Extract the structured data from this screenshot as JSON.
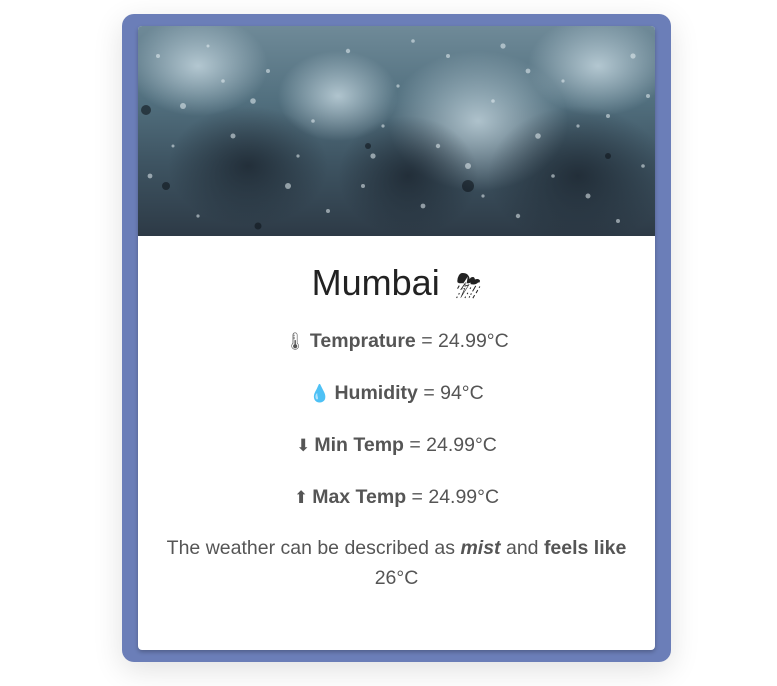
{
  "city": "Mumbai",
  "weather_icon": "storm-cloud-icon",
  "weather_glyph": "⛈",
  "stats": [
    {
      "icon": "thermometer-icon",
      "glyph": "🌡",
      "label": "Temprature",
      "value": "= 24.99°C"
    },
    {
      "icon": "droplet-icon",
      "glyph": "💧",
      "label": "Humidity",
      "value": "= 94°C"
    },
    {
      "icon": "arrow-down-icon",
      "glyph": "⬇",
      "label": "Min Temp",
      "value": "= 24.99°C"
    },
    {
      "icon": "arrow-up-icon",
      "glyph": "⬆",
      "label": "Max Temp",
      "value": "= 24.99°C"
    }
  ],
  "description": {
    "prefix": "The weather can be described as",
    "condition": "mist",
    "middle": "and",
    "feels_label": "feels like",
    "feels_value": "26°C"
  },
  "colors": {
    "frame": "#6b7eb8",
    "card": "#ffffff",
    "text": "#555555",
    "title": "#222222"
  }
}
